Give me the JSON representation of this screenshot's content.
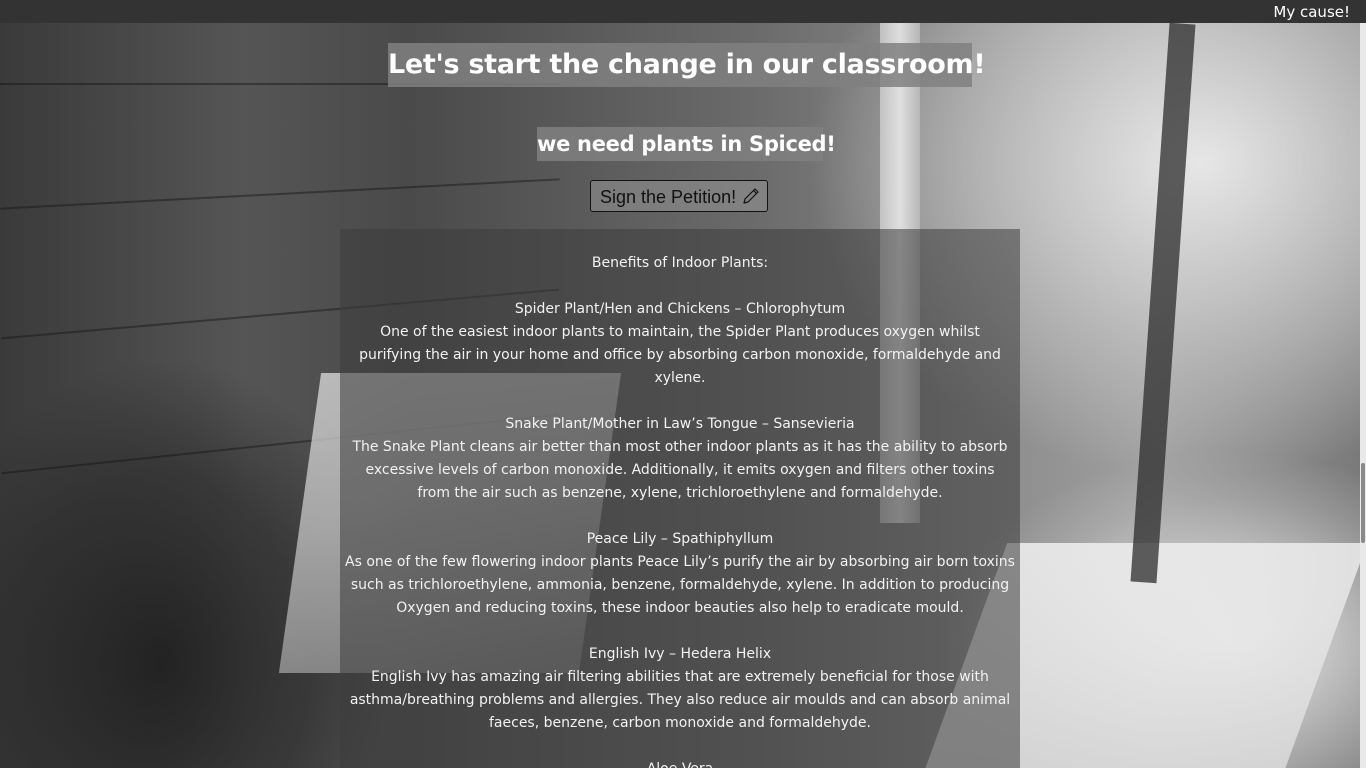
{
  "topbar": {
    "brand": "My cause!"
  },
  "hero": {
    "title": "Let's start the change in our classroom!",
    "subtitle": "we need plants in Spiced!",
    "cta_label": "Sign the Petition!",
    "cta_icon": "pencil-icon"
  },
  "panel": {
    "intro": "Benefits of Indoor Plants:",
    "plants": [
      {
        "name": "Spider Plant/Hen and Chickens – Chlorophytum",
        "description": "One of the easiest indoor plants to maintain, the Spider Plant produces oxygen whilst purifying the air in your home and office by absorbing carbon monoxide, formaldehyde and xylene."
      },
      {
        "name": "Snake Plant/Mother in Law’s Tongue – Sansevieria",
        "description": "The Snake Plant cleans air better than most other indoor plants as it has the ability to absorb excessive levels of carbon monoxide. Additionally, it emits oxygen and filters other toxins from the air such as benzene, xylene, trichloroethylene and formaldehyde."
      },
      {
        "name": "Peace Lily – Spathiphyllum",
        "description": "As one of the few flowering indoor plants Peace Lily’s purify the air by absorbing air born toxins such as trichloroethylene, ammonia, benzene, formaldehyde, xylene. In addition to producing Oxygen and reducing toxins, these indoor beauties also help to eradicate mould."
      },
      {
        "name": "English Ivy – Hedera Helix",
        "description": "English Ivy has amazing air filtering abilities that are extremely beneficial for those with asthma/breathing problems and allergies. They also reduce air moulds and can absorb animal faeces, benzene, carbon monoxide and formaldehyde."
      },
      {
        "name": "Aloe Vera",
        "description": ""
      }
    ]
  }
}
